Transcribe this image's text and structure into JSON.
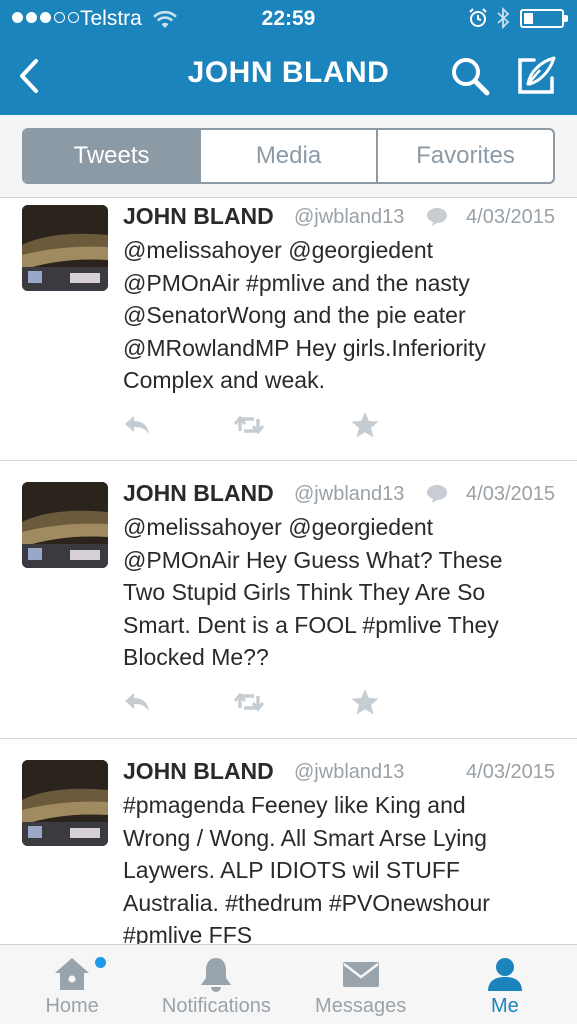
{
  "status_bar": {
    "carrier": "Telstra",
    "time": "22:59",
    "signal_bars_filled": 3,
    "signal_bars_total": 5,
    "battery_level": 0.25
  },
  "nav": {
    "title": "JOHN BLAND",
    "back_icon": "chevron-left-icon",
    "search_icon": "search-icon",
    "compose_icon": "compose-icon"
  },
  "segments": {
    "tabs": [
      {
        "label": "Tweets",
        "active": true
      },
      {
        "label": "Media",
        "active": false
      },
      {
        "label": "Favorites",
        "active": false
      }
    ]
  },
  "tweets": [
    {
      "name": "JOHN BLAND",
      "handle": "@jwbland13",
      "date": "4/03/2015",
      "has_reply_icon": true,
      "lines": [
        "@melissahoyer @georgiedent",
        "@PMOnAir #pmlive and the nasty",
        "@SenatorWong and the pie eater",
        "@MRowlandMP Hey girls.Inferiority",
        "Complex and weak."
      ]
    },
    {
      "name": "JOHN BLAND",
      "handle": "@jwbland13",
      "date": "4/03/2015",
      "has_reply_icon": true,
      "lines": [
        "@melissahoyer @georgiedent",
        "@PMOnAir Hey Guess What? These",
        "Two Stupid Girls Think They Are So",
        "Smart. Dent is a FOOL #pmlive They",
        "Blocked Me??"
      ]
    },
    {
      "name": "JOHN BLAND",
      "handle": "@jwbland13",
      "date": "4/03/2015",
      "has_reply_icon": false,
      "lines": [
        "#pmagenda Feeney like King and",
        "Wrong / Wong. All Smart Arse Lying",
        "Laywers. ALP IDIOTS wil STUFF",
        "Australia. #thedrum #PVOnewshour",
        "#pmlive FFS"
      ]
    }
  ],
  "tab_bar": {
    "items": [
      {
        "label": "Home",
        "icon": "home-icon",
        "active": false,
        "has_badge": true
      },
      {
        "label": "Notifications",
        "icon": "bell-icon",
        "active": false,
        "has_badge": false
      },
      {
        "label": "Messages",
        "icon": "envelope-icon",
        "active": false,
        "has_badge": false
      },
      {
        "label": "Me",
        "icon": "person-icon",
        "active": true,
        "has_badge": false
      }
    ]
  },
  "colors": {
    "brand_blue": "#1b84bd",
    "segment_gray": "#8c9aa6",
    "meta_gray": "#9aa1a7"
  }
}
